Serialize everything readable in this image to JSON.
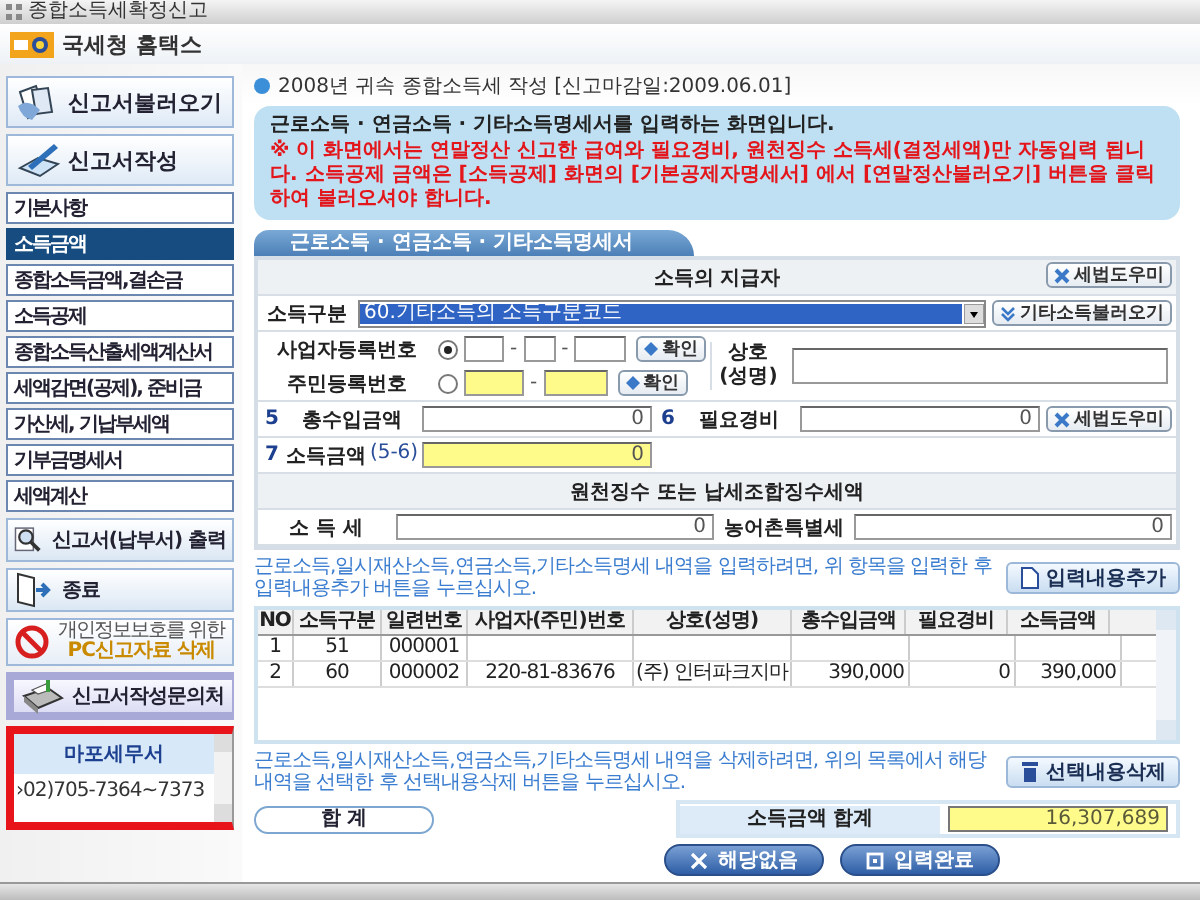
{
  "window": {
    "title": "종합소득세확정신고"
  },
  "header": {
    "brand": "국세청 홈택스"
  },
  "sidebar": {
    "top_buttons": [
      {
        "label": "신고서불러오기",
        "kind": "open"
      },
      {
        "label": "신고서작성",
        "kind": "write"
      }
    ],
    "menu": [
      {
        "label": "기본사항",
        "selected": false
      },
      {
        "label": "소득금액",
        "selected": true
      },
      {
        "label": "종합소득금액,결손금",
        "selected": false
      },
      {
        "label": "소득공제",
        "selected": false
      },
      {
        "label": "종합소득산출세액계산서",
        "selected": false
      },
      {
        "label": "세액감면(공제), 준비금",
        "selected": false
      },
      {
        "label": "가산세, 기납부세액",
        "selected": false
      },
      {
        "label": "기부금명세서",
        "selected": false
      },
      {
        "label": "세액계산",
        "selected": false
      }
    ],
    "bottom_buttons": [
      {
        "label": "신고서(납부서) 출력",
        "kind": "print"
      },
      {
        "label": "종료",
        "kind": "exit"
      },
      {
        "label": "PC신고자료 삭제",
        "note": "개인정보보호를 위한",
        "kind": "delete"
      },
      {
        "label": "신고서작성문의처",
        "kind": "contact"
      }
    ],
    "contact": {
      "office": "마포세무서",
      "phone": "›02)705-7364~7373"
    }
  },
  "date_line": "2008년 귀속 종합소득세 작성 [신고마감일:2009.06.01]",
  "notice": {
    "title": "근로소득 · 연금소득 · 기타소득명세서를 입력하는 화면입니다.",
    "warning": "※ 이 화면에서는 연말정산 신고한 급여와 필요경비, 원천징수 소득세(결정세액)만 자동입력 됩니다. 소득공제 금액은 [소득공제] 화면의 [기본공제자명세서] 에서 [연말정산불러오기] 버튼을 클릭하여 불러오셔야 합니다."
  },
  "form": {
    "tab": "근로소득 · 연금소득 · 기타소득명세서",
    "payer_heading": "소득의 지급자",
    "help_button": "세법도우미",
    "income_type": {
      "label": "소득구분",
      "value": "60.기타소득의 소득구분코드",
      "button": "기타소득불러오기"
    },
    "id_options": [
      {
        "label": "사업자등록번호",
        "selected": true,
        "button": "확인",
        "separators": [
          "-",
          "-"
        ]
      },
      {
        "label": "주민등록번호",
        "selected": false,
        "button": "확인",
        "separators": [
          "-"
        ]
      }
    ],
    "name_label": "상호 (성명)",
    "total_income": {
      "number": "5",
      "label": "총수입금액",
      "value": "0"
    },
    "expenses": {
      "number": "6",
      "label": "필요경비",
      "value": "0",
      "button": "세법도우미"
    },
    "income_amount": {
      "number": "7",
      "label": "소득금액",
      "formula": "(5-6)",
      "value": "0"
    },
    "withholding_heading": "원천징수 또는 납세조합징수세액",
    "income_tax": {
      "label": "소 득 세",
      "value": "0"
    },
    "rural_tax": {
      "label": "농어촌특별세",
      "value": "0"
    }
  },
  "add_hint": "근로소득,일시재산소득,연금소득,기타소득명세 내역을 입력하려면, 위 항목을 입력한 후 입력내용추가 버튼을 누르십시오.",
  "add_button": "입력내용추가",
  "list": {
    "columns": [
      "NO",
      "소득구분",
      "일련번호",
      "사업자(주민)번호",
      "상호(성명)",
      "총수입금액",
      "필요경비",
      "소득금액"
    ],
    "rows": [
      [
        "1",
        "51",
        "000001"
      ],
      [
        "2",
        "60",
        "000002",
        "220-81-83676",
        "(주) 인터파크지마",
        "390,000",
        "0",
        "390,000"
      ]
    ]
  },
  "delete_hint": "근로소득,일시재산소득,연금소득,기타소득명세 내역을 삭제하려면, 위의 목록에서 해당내역을 선택한 후 선택내용삭제 버튼을 누르십시오.",
  "delete_button": "선택내용삭제",
  "total": {
    "button": "합 계",
    "label": "소득금액 합계",
    "value": "16,307,689"
  },
  "footer_buttons": [
    {
      "label": "해당없음",
      "kind": "cancel"
    },
    {
      "label": "입력완료",
      "kind": "done"
    }
  ]
}
